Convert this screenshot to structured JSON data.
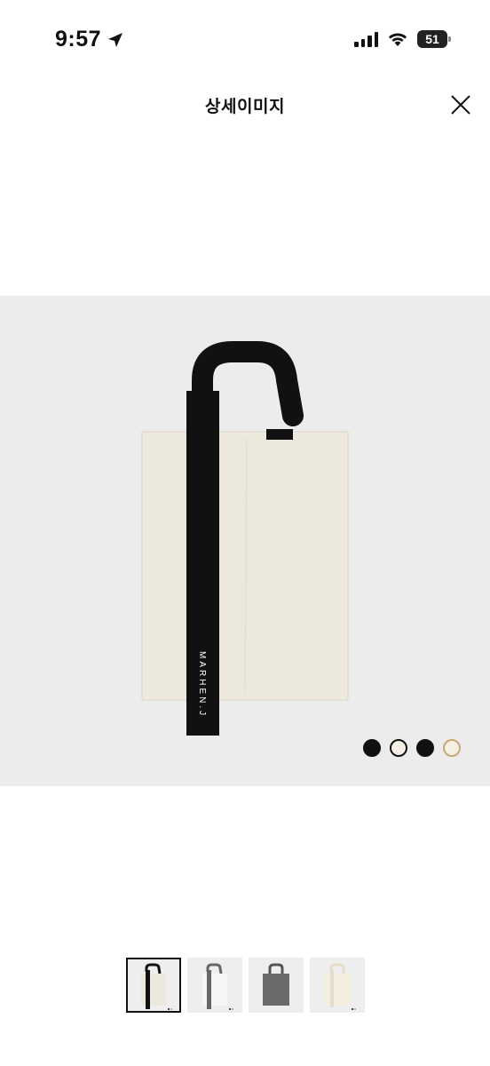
{
  "status": {
    "time": "9:57",
    "battery": "51"
  },
  "header": {
    "title": "상세이미지"
  },
  "product": {
    "brand_text": "MARHEN.J",
    "color_swatches": [
      "#111111",
      "#f3efe4",
      "#111111",
      "#f3efe4"
    ],
    "swatch_borders": [
      "#111111",
      "#111111",
      "#111111",
      "#c9a878"
    ]
  },
  "thumbnails": [
    {
      "name": "black-strap-ivory",
      "active": true
    },
    {
      "name": "grey-strap-white",
      "active": false
    },
    {
      "name": "grey-bag",
      "active": false
    },
    {
      "name": "ivory-bag",
      "active": false
    }
  ]
}
